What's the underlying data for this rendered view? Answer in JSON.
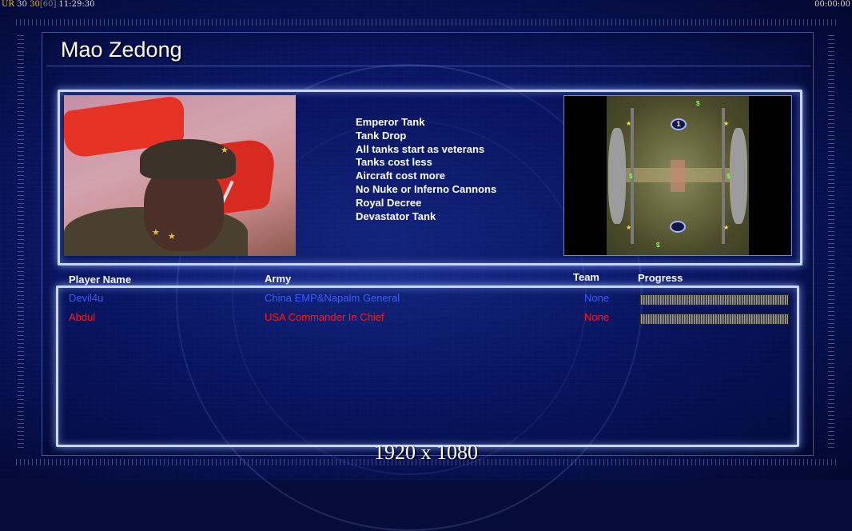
{
  "hud": {
    "left_prefix": "UR",
    "left_a": "30",
    "left_b": "30",
    "left_c": "[60]",
    "left_time": "11:29:30",
    "right_time": "00:00:00"
  },
  "general": {
    "name": "Mao Zedong",
    "powers": [
      "Emperor Tank",
      "Tank Drop",
      "All tanks start as veterans",
      "Tanks cost less",
      "Aircraft cost more",
      "No Nuke or Inferno Cannons",
      "Royal Decree",
      "Devastator Tank"
    ]
  },
  "minimap": {
    "marker_1": "1",
    "marker_2": ""
  },
  "columns": {
    "player_name": "Player Name",
    "army": "Army",
    "team": "Team",
    "progress": "Progress"
  },
  "players": [
    {
      "name": "Devil4u",
      "army": "China EMP&Napalm General",
      "team": "None",
      "color": "#3a5cff"
    },
    {
      "name": "Abdul",
      "army": "USA Commander In Chief",
      "team": "None",
      "color": "#ff1a1a"
    }
  ],
  "resolution": "1920 x 1080",
  "colors": {
    "panel_border": "#c9d6ff",
    "background": "#0a1560"
  }
}
